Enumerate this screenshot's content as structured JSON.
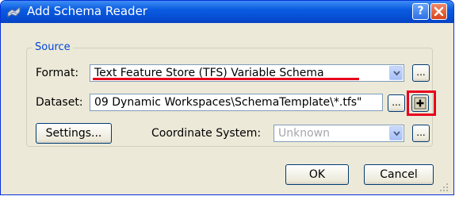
{
  "window": {
    "title": "Add Schema Reader",
    "help_label": "?",
    "close_label": "✕"
  },
  "source_group": {
    "label": "Source"
  },
  "format": {
    "label": "Format:",
    "value": "Text Feature Store (TFS) Variable Schema",
    "browse_label": "..."
  },
  "dataset": {
    "label": "Dataset:",
    "value": "09 Dynamic Workspaces\\SchemaTemplate\\*.tfs\"",
    "browse_label": "...",
    "add_icon": "plus-icon"
  },
  "settings": {
    "label": "Settings..."
  },
  "coordinate_system": {
    "label": "Coordinate System:",
    "value": "Unknown",
    "browse_label": "..."
  },
  "footer": {
    "ok_label": "OK",
    "cancel_label": "Cancel"
  },
  "colors": {
    "titlebar": "#0a5be0",
    "group_label": "#0046d5",
    "annotation": "#e8001c",
    "window_bg": "#ece9d8"
  }
}
